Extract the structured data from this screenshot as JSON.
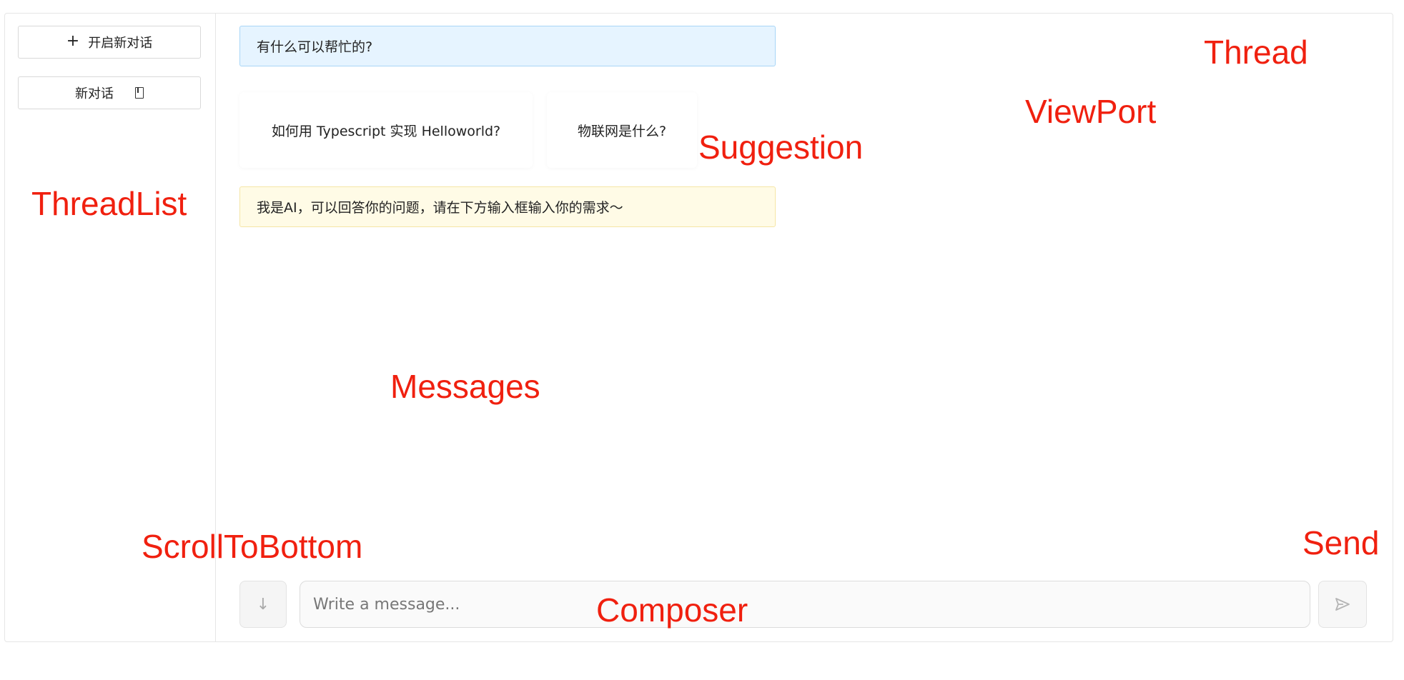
{
  "thread_list": {
    "new_button_label": "开启新对话",
    "items": [
      {
        "label": "新对话"
      }
    ]
  },
  "thread": {
    "welcome_message": "有什么可以帮忙的?",
    "suggestions": [
      {
        "label": "如何用 Typescript 实现 Helloworld?"
      },
      {
        "label": "物联网是什么?"
      }
    ],
    "assistant_notice": "我是AI，可以回答你的问题，请在下方输入框输入你的需求～"
  },
  "composer": {
    "placeholder": "Write a message...",
    "value": ""
  },
  "annotations": {
    "thread": "Thread",
    "viewport": "ViewPort",
    "suggestion": "Suggestion",
    "threadlist": "ThreadList",
    "messages": "Messages",
    "scroll_to_bottom": "ScrollToBottom",
    "send": "Send",
    "composer": "Composer"
  },
  "colors": {
    "annotation": "#f0200f",
    "welcome_bg": "#e6f4ff",
    "notice_bg": "#fffbe6"
  }
}
